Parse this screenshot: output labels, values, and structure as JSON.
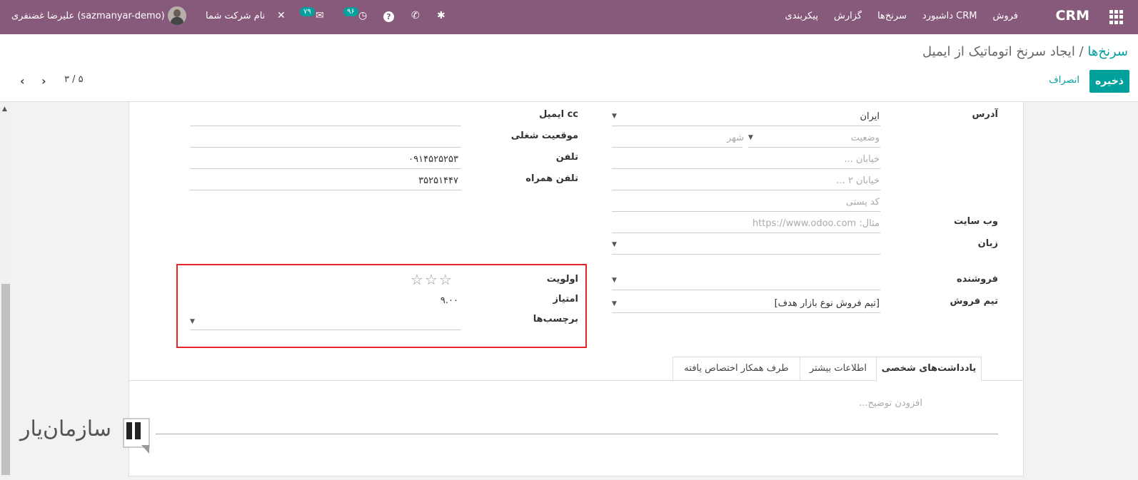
{
  "navbar": {
    "app_name": "CRM",
    "menus": [
      "فروش",
      "داشبورد CRM",
      "سرنخ‌ها",
      "گزارش",
      "پیکربندی"
    ],
    "messages_count": "۷۹",
    "activities_count": "۹۶",
    "company": "نام شرکت شما",
    "user": "علیرضا غضنفری (sazmanyar-demo)"
  },
  "breadcrumb": {
    "parent": "سرنخ‌ها",
    "separator": "/",
    "current": "ایجاد سرنخ اتوماتیک از ایمیل"
  },
  "actions": {
    "save": "ذخیره",
    "discard": "انصراف"
  },
  "pager": {
    "value": "۳ / ۵"
  },
  "form": {
    "address_label": "آدرس",
    "country": "ایران",
    "state_placeholder": "وضعیت",
    "city_placeholder": "شهر",
    "street_placeholder": "خیابان ...",
    "street2_placeholder": "خیابان ۲ ...",
    "zip_placeholder": "کد پستی",
    "website_label": "وب سایت",
    "website_placeholder": "مثال: https://www.odoo.com",
    "language_label": "زبان",
    "salesperson_label": "فروشنده",
    "sales_team_label": "تیم فروش",
    "sales_team_value": "[تیم فروش نوع بازار هدف]",
    "email_cc_label": "cc ایمیل",
    "job_position_label": "موقعیت شغلی",
    "phone_label": "تلفن",
    "phone_value": "۰۹۱۴۵۲۵۲۵۳",
    "mobile_label": "تلفن همراه",
    "mobile_value": "۳۵۲۵۱۴۴۷",
    "priority_label": "اولویت",
    "score_label": "امتیاز",
    "score_value": "۹.۰۰",
    "tags_label": "برچسب‌ها"
  },
  "tabs": [
    {
      "label": "یادداشت‌های شخصی",
      "active": true
    },
    {
      "label": "اطلاعات بیشتر",
      "active": false
    },
    {
      "label": "طرف همکار اختصاص یافته",
      "active": false
    }
  ],
  "notes_placeholder": "افزودن توضیح...",
  "watermark": {
    "text": "سازمان‌یار"
  },
  "colors": {
    "navbar": "#875a7b",
    "accent": "#00a09d",
    "highlight": "#e4262a"
  }
}
